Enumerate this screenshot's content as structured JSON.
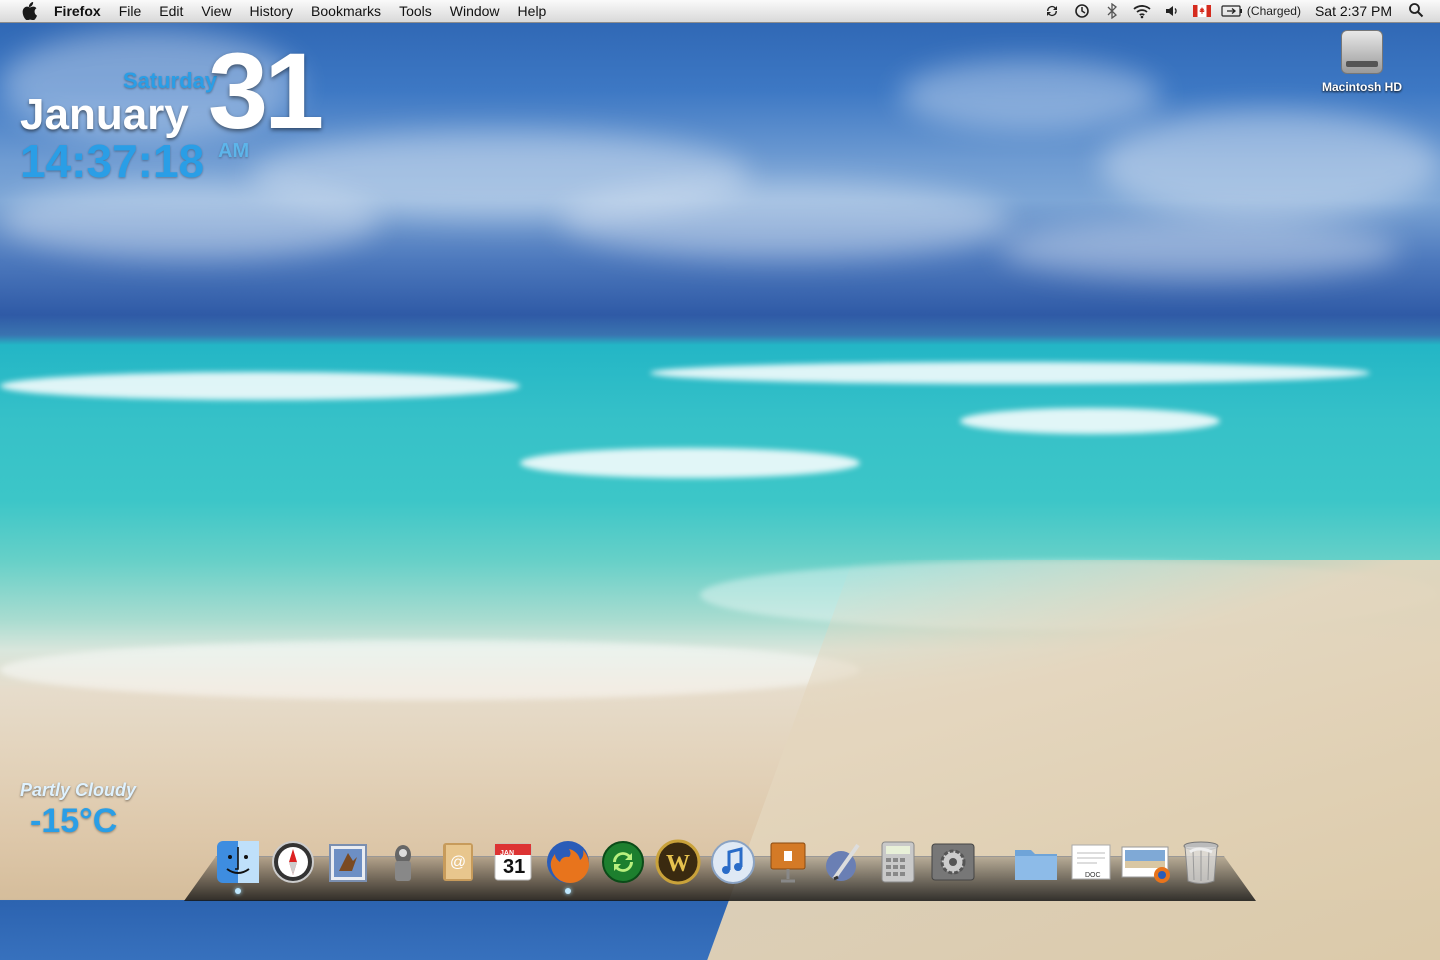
{
  "menubar": {
    "app_name": "Firefox",
    "items": [
      "File",
      "Edit",
      "View",
      "History",
      "Bookmarks",
      "Tools",
      "Window",
      "Help"
    ],
    "battery_text": "(Charged)",
    "clock": "Sat 2:37 PM",
    "status_icons": [
      "sync-icon",
      "time-machine-icon",
      "bluetooth-icon",
      "wifi-icon",
      "volume-icon",
      "canada-flag-icon",
      "battery-icon"
    ]
  },
  "clock_widget": {
    "day": "Saturday",
    "month": "January",
    "date": "31",
    "time": "14:37:18",
    "ampm": "AM",
    "accent_color": "#2a9ee6"
  },
  "weather_widget": {
    "condition": "Partly Cloudy",
    "temperature": "-15°C"
  },
  "desktop": {
    "hd_label": "Macintosh HD"
  },
  "dock": {
    "apps": [
      "finder-icon",
      "safari-icon",
      "mail-icon",
      "preview-icon",
      "address-book-icon",
      "ical-icon",
      "firefox-icon",
      "sync-app-icon",
      "world-of-warcraft-icon",
      "itunes-icon",
      "keynote-icon",
      "script-editor-icon",
      "calculator-icon",
      "system-preferences-icon"
    ],
    "stacks": [
      "folder-stack-icon",
      "document-icon",
      "downloads-icon",
      "trash-icon"
    ],
    "ical_month": "JAN",
    "ical_day": "31",
    "doc_label": "DOC"
  }
}
